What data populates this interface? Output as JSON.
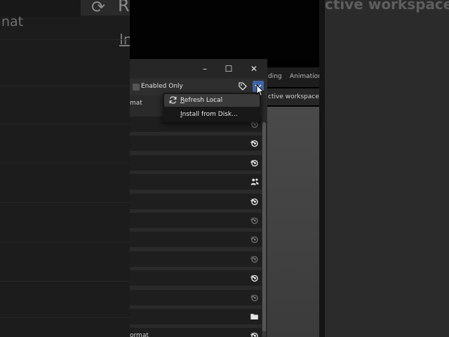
{
  "background": {
    "left_text": "nat",
    "left_underline_text": "In",
    "left_title_fragment": "R",
    "right_title_fragment": "ctive workspace s"
  },
  "editor": {
    "tabs": [
      "ding",
      "Animation"
    ],
    "status": "ctive workspace sh"
  },
  "dialog": {
    "window_controls": {
      "minimize": "–",
      "maximize": "☐",
      "close": "✕"
    },
    "enabled_only_label": "Enabled Only",
    "enabled_only_checked": false,
    "column_header": "mat",
    "rows": [
      {
        "icon": "blender-icon",
        "dim": true
      },
      {
        "icon": "blender-icon",
        "dim": false
      },
      {
        "icon": "blender-icon",
        "dim": false
      },
      {
        "icon": "community-icon",
        "dim": false
      },
      {
        "icon": "blender-icon",
        "dim": false
      },
      {
        "icon": "blender-icon",
        "dim": true
      },
      {
        "icon": "blender-icon",
        "dim": true
      },
      {
        "icon": "blender-icon",
        "dim": true
      },
      {
        "icon": "blender-icon",
        "dim": false
      },
      {
        "icon": "blender-icon",
        "dim": true
      },
      {
        "icon": "folder-icon",
        "dim": false
      },
      {
        "icon": "blender-icon",
        "dim": false,
        "label": "ormat"
      }
    ]
  },
  "menu": {
    "items": [
      {
        "label": "Refresh Local",
        "underline": "R",
        "icon": "refresh-icon"
      },
      {
        "label": "Install from Disk...",
        "underline": "I",
        "icon": ""
      }
    ]
  },
  "colors": {
    "accent": "#3d64a8",
    "dialog_bg": "#2a2a2a",
    "row_bg": "#1e1e1e"
  }
}
